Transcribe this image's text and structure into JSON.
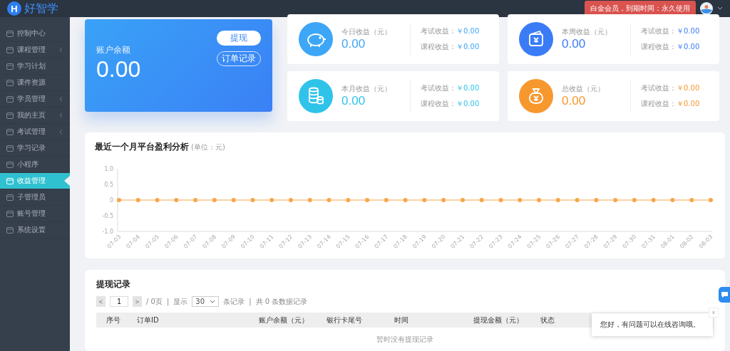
{
  "logo": {
    "mark": "H",
    "text": "好智学"
  },
  "header": {
    "membership": "白金会员，到期时间：永久使用"
  },
  "sidebar": {
    "items": [
      {
        "label": "控制中心",
        "has_arrow": false,
        "selected": false
      },
      {
        "label": "课程管理",
        "has_arrow": true,
        "selected": false
      },
      {
        "label": "学习计划",
        "has_arrow": false,
        "selected": false
      },
      {
        "label": "课件资源",
        "has_arrow": false,
        "selected": false
      },
      {
        "label": "学员管理",
        "has_arrow": true,
        "selected": false
      },
      {
        "label": "我的主页",
        "has_arrow": true,
        "selected": false
      },
      {
        "label": "考试管理",
        "has_arrow": true,
        "selected": false
      },
      {
        "label": "学习记录",
        "has_arrow": false,
        "selected": false
      },
      {
        "label": "小程序",
        "has_arrow": false,
        "selected": false
      },
      {
        "label": "收益管理",
        "has_arrow": false,
        "selected": true
      },
      {
        "label": "子管理员",
        "has_arrow": false,
        "selected": false
      },
      {
        "label": "账号管理",
        "has_arrow": false,
        "selected": false
      },
      {
        "label": "系统设置",
        "has_arrow": false,
        "selected": false
      }
    ]
  },
  "balance": {
    "label": "账户余额",
    "amount": "0.00",
    "buttons": [
      "提现",
      "订单记录"
    ]
  },
  "stats": [
    {
      "title": "今日收益（元）",
      "amount": "0.00",
      "color": "#3ea6f7",
      "exam_label": "考试收益：",
      "exam": "￥0.00",
      "course_label": "课程收益：",
      "course": "￥0.00"
    },
    {
      "title": "本周收益（元）",
      "amount": "0.00",
      "color": "#3b7cf6",
      "exam_label": "考试收益：",
      "exam": "￥0.00",
      "course_label": "课程收益：",
      "course": "￥0.00"
    },
    {
      "title": "本月收益（元）",
      "amount": "0.00",
      "color": "#2fc3ea",
      "exam_label": "考试收益：",
      "exam": "￥0.00",
      "course_label": "课程收益：",
      "course": "￥0.00"
    },
    {
      "title": "总收益（元）",
      "amount": "0.00",
      "color": "#f7982e",
      "exam_label": "考试收益：",
      "exam": "￥0.00",
      "course_label": "课程收益：",
      "course": "￥0.00"
    }
  ],
  "profit_chart": {
    "title": "最近一个月平台盈利分析",
    "unit": "(单位：元)",
    "chart_data": {
      "type": "line",
      "categories": [
        "07-03",
        "07-04",
        "07-05",
        "07-06",
        "07-07",
        "07-08",
        "07-09",
        "07-10",
        "07-11",
        "07-12",
        "07-13",
        "07-14",
        "07-15",
        "07-16",
        "07-17",
        "07-18",
        "07-19",
        "07-20",
        "07-21",
        "07-22",
        "07-23",
        "07-24",
        "07-25",
        "07-26",
        "07-27",
        "07-28",
        "07-29",
        "07-30",
        "07-31",
        "08-01",
        "08-02",
        "08-03"
      ],
      "series": [
        {
          "color": "#f7a64a",
          "marker": "circle",
          "values": [
            0,
            0,
            0,
            0,
            0,
            0,
            0,
            0,
            0,
            0,
            0,
            0,
            0,
            0,
            0,
            0,
            0,
            0,
            0,
            0,
            0,
            0,
            0,
            0,
            0,
            0,
            0,
            0,
            0,
            0,
            0,
            0
          ]
        }
      ],
      "ylim": [
        -1,
        1
      ],
      "yticks": [
        {
          "value": 1,
          "label": "1.0"
        },
        {
          "value": 0.5,
          "label": "0.5"
        },
        {
          "value": 0,
          "label": "0"
        },
        {
          "value": -0.5,
          "label": "-0.5"
        },
        {
          "value": -1,
          "label": "-1.0"
        }
      ]
    }
  },
  "records": {
    "title": "提现记录",
    "prev": "<",
    "page": "1",
    "next": ">",
    "pages": "/ 0页",
    "sep": "|",
    "show": "显示",
    "page_size": "30",
    "per_page": "条记录",
    "total": "共 0 条数据记录",
    "columns": [
      "序号",
      "订单ID",
      "账户余额（元）",
      "银行卡尾号",
      "时间",
      "提现金额（元）",
      "状态"
    ],
    "empty": "暂时没有提现记录"
  },
  "chat_popup": {
    "message": "您好，有问题可以在线咨询哦。",
    "close": "×"
  }
}
